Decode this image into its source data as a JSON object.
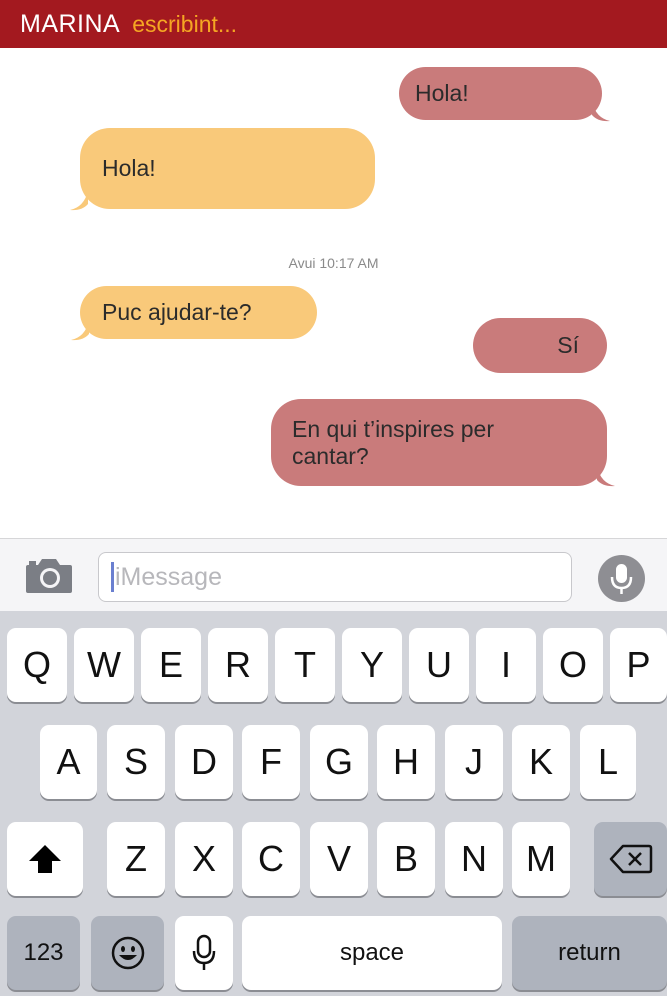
{
  "header": {
    "contact_name": "MARINA",
    "status": "escribint..."
  },
  "messages": [
    {
      "side": "out",
      "text": "Hola!"
    },
    {
      "side": "in",
      "text": "Hola!"
    },
    {
      "side": "in",
      "text": "Puc ajudar-te?"
    },
    {
      "side": "out",
      "text": "Sí"
    },
    {
      "side": "out",
      "text": "En qui t’inspires per cantar?"
    }
  ],
  "timestamp": "Avui 10:17 AM",
  "input": {
    "placeholder": "iMessage",
    "camera_icon": "camera-icon",
    "mic_icon": "microphone-icon"
  },
  "keyboard": {
    "row1": [
      "Q",
      "W",
      "E",
      "R",
      "T",
      "Y",
      "U",
      "I",
      "O",
      "P"
    ],
    "row2": [
      "A",
      "S",
      "D",
      "F",
      "G",
      "H",
      "J",
      "K",
      "L"
    ],
    "row3": [
      "Z",
      "X",
      "C",
      "V",
      "B",
      "N",
      "M"
    ],
    "shift_icon": "shift-arrow-icon",
    "backspace_icon": "backspace-icon",
    "numbers_label": "123",
    "emoji_icon": "emoji-icon",
    "dictation_icon": "microphone-icon",
    "space_label": "space",
    "return_label": "return"
  },
  "colors": {
    "header_bg": "#a3191f",
    "status_text": "#f5a623",
    "outgoing_bubble": "#c97b7b",
    "incoming_bubble": "#f9c97a",
    "keyboard_bg": "#d2d4da",
    "special_key": "#aeb3bd"
  }
}
